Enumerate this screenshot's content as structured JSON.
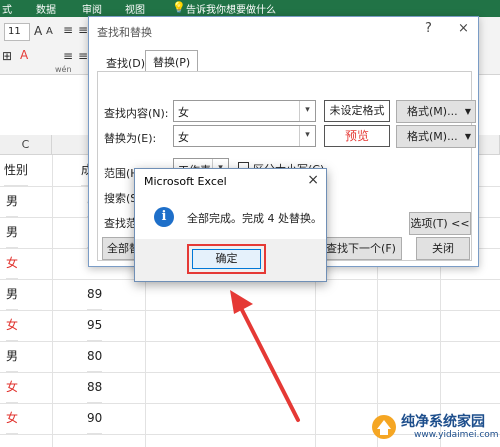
{
  "ribbon": {
    "tabs": [
      "式",
      "数据",
      "审阅",
      "视图",
      "告诉我你想要做什么"
    ],
    "font_size": "11",
    "glyphs": [
      "A",
      "A",
      "≡",
      "≡",
      "≡",
      "ab",
      "≡",
      "≡",
      "≡",
      "⊞",
      "A",
      "wén"
    ]
  },
  "sheet": {
    "column_header": "C",
    "rows": [
      {
        "gender": "性别",
        "score": "成"
      },
      {
        "gender": "男",
        "score": "8"
      },
      {
        "gender": "男",
        "score": "("
      },
      {
        "gender": "女",
        "score": ""
      },
      {
        "gender": "男",
        "score": "89"
      },
      {
        "gender": "女",
        "score": "95"
      },
      {
        "gender": "男",
        "score": "80"
      },
      {
        "gender": "女",
        "score": "88"
      },
      {
        "gender": "女",
        "score": "90"
      }
    ]
  },
  "find_dialog": {
    "title": "查找和替换",
    "help": "?",
    "close": "×",
    "tab_find": "查找(D)",
    "tab_replace": "替换(P)",
    "find_label": "查找内容(N):",
    "find_value": "女",
    "find_format": "未设定格式",
    "replace_label": "替换为(E):",
    "replace_value": "女",
    "replace_format": "预览",
    "format_button": "格式(M)...",
    "scope_label": "范围(H):",
    "scope_value": "工作表",
    "match_case": "区分大小写(C)",
    "search_label": "搜索(S)",
    "lookin_label": "查找范",
    "options_button": "选项(T) <<",
    "replace_all_button": "全部替",
    "find_next_button": "查找下一个(F)",
    "close_button": "关闭"
  },
  "msgbox": {
    "title": "Microsoft Excel",
    "close": "×",
    "icon": "info-icon",
    "text": "全部完成。完成 4 处替换。",
    "ok_button": "确定"
  },
  "watermark": {
    "name": "纯净系统家园",
    "url": "www.yidaimei.com"
  },
  "colors": {
    "excel_green": "#217346",
    "annotation_red": "#e53935",
    "female_red": "#e0302b"
  }
}
